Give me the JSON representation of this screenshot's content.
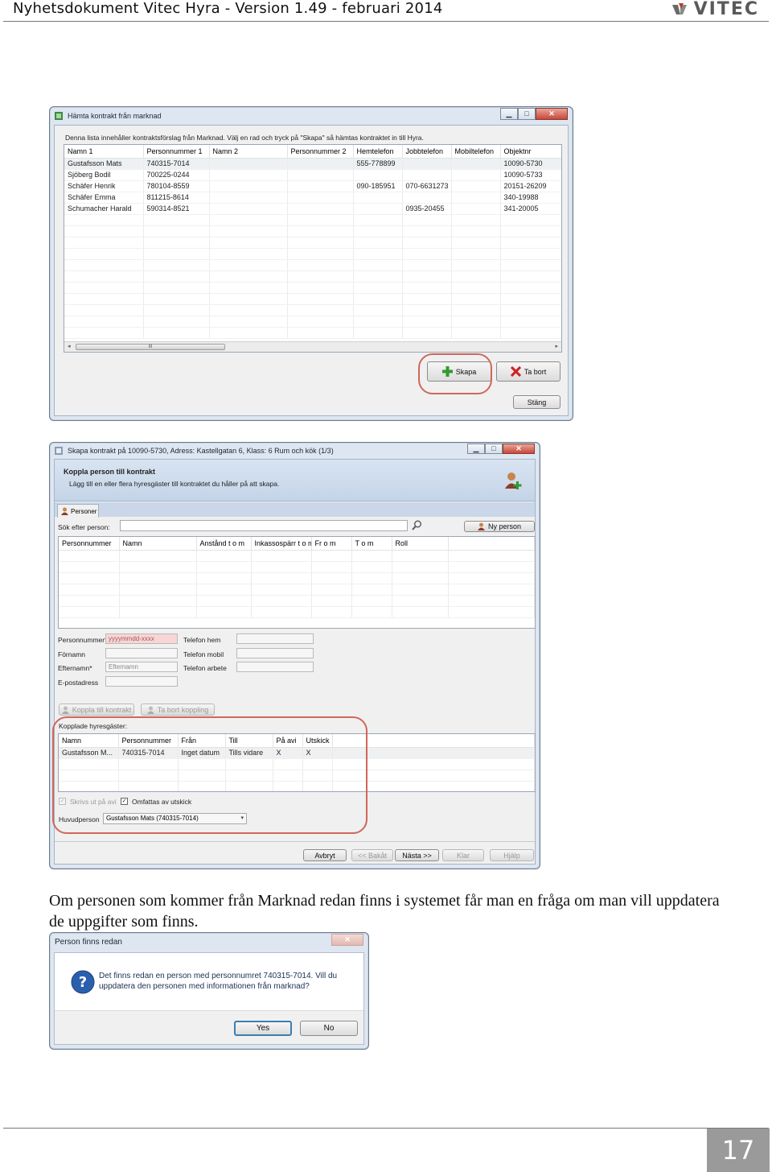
{
  "header": {
    "title": "Nyhetsdokument Vitec Hyra - Version 1.49 - februari 2014",
    "logo_text": "VITEC",
    "logo_color": "#5a5a5a"
  },
  "window1": {
    "title": "Hämta kontrakt från marknad",
    "instruction": "Denna lista innehåller kontraktsförslag från Marknad. Välj en rad och tryck på \"Skapa\" så hämtas kontraktet in till Hyra.",
    "columns": [
      "Namn 1",
      "Personnummer 1",
      "Namn 2",
      "Personnummer 2",
      "Hemtelefon",
      "Jobbtelefon",
      "Mobiltelefon",
      "Objektnr"
    ],
    "rows": [
      [
        "Gustafsson Mats",
        "740315-7014",
        "",
        "",
        "555-778899",
        "",
        "",
        "10090-5730"
      ],
      [
        "Sjöberg Bodil",
        "700225-0244",
        "",
        "",
        "",
        "",
        "",
        "10090-5733"
      ],
      [
        "Schäfer Henrik",
        "780104-8559",
        "",
        "",
        "090-185951",
        "070-6631273",
        "",
        "20151-26209"
      ],
      [
        "Schäfer Emma",
        "811215-8614",
        "",
        "",
        "",
        "",
        "",
        "340-19988"
      ],
      [
        "Schumacher Harald",
        "590314-8521",
        "",
        "",
        "",
        "0935-20455",
        "",
        "341-20005"
      ]
    ],
    "scroll_glyph": "III",
    "btn_create": "Skapa",
    "btn_delete": "Ta bort",
    "btn_close": "Stäng"
  },
  "window2": {
    "title": "Skapa kontrakt på 10090-5730, Adress: Kastellgatan 6, Klass: 6 Rum och kök (1/3)",
    "section_title": "Koppla person till kontrakt",
    "section_desc": "Lägg till en eller flera hyresgäster till kontraktet du håller på att skapa.",
    "tab_persons": "Personer",
    "search_label": "Sök efter person:",
    "search_value": "",
    "btn_new_person": "Ny person",
    "person_columns": [
      "Personnummer",
      "Namn",
      "Anstånd t o m",
      "Inkassospärr t o m",
      "Fr o m",
      "T o m",
      "Roll"
    ],
    "labels": {
      "personnummer": "Personnummer*",
      "fornamn": "Förnamn",
      "efternamn": "Efternamn*",
      "epost": "E-postadress",
      "tel_hem": "Telefon hem",
      "tel_mobil": "Telefon mobil",
      "tel_arbete": "Telefon arbete"
    },
    "placeholders": {
      "personnummer": "yyyymmdd-xxxx",
      "efternamn": "Efternamn"
    },
    "btn_link": "Koppla till kontrakt",
    "btn_unlink": "Ta bort koppling",
    "linked_title": "Kopplade hyresgäster:",
    "linked_columns": [
      "Namn",
      "Personnummer",
      "Från",
      "Till",
      "På avi",
      "Utskick"
    ],
    "linked_rows": [
      [
        "Gustafsson M...",
        "740315-7014",
        "Inget datum",
        "Tills vidare",
        "X",
        "X"
      ]
    ],
    "chk_print": "Skrivs ut på avi",
    "chk_included": "Omfattas av utskick",
    "main_person_label": "Huvudperson",
    "main_person_value": "Gustafsson Mats (740315-7014)",
    "footer_buttons": [
      "Avbryt",
      "<< Bakåt",
      "Nästa >>",
      "Klar",
      "Hjälp"
    ]
  },
  "body_text": "Om personen som kommer från Marknad redan finns i systemet får man en fråga om man vill uppdatera de uppgifter som finns.",
  "dialog": {
    "title": "Person finns redan",
    "message": "Det finns redan en person med personnumret 740315-7014. Vill du uppdatera den personen med informationen från marknad?",
    "btn_yes": "Yes",
    "btn_no": "No"
  },
  "page_number": "17",
  "colors": {
    "highlight_oval": "#d0675a",
    "page_number_bg": "#9a9a9a"
  }
}
